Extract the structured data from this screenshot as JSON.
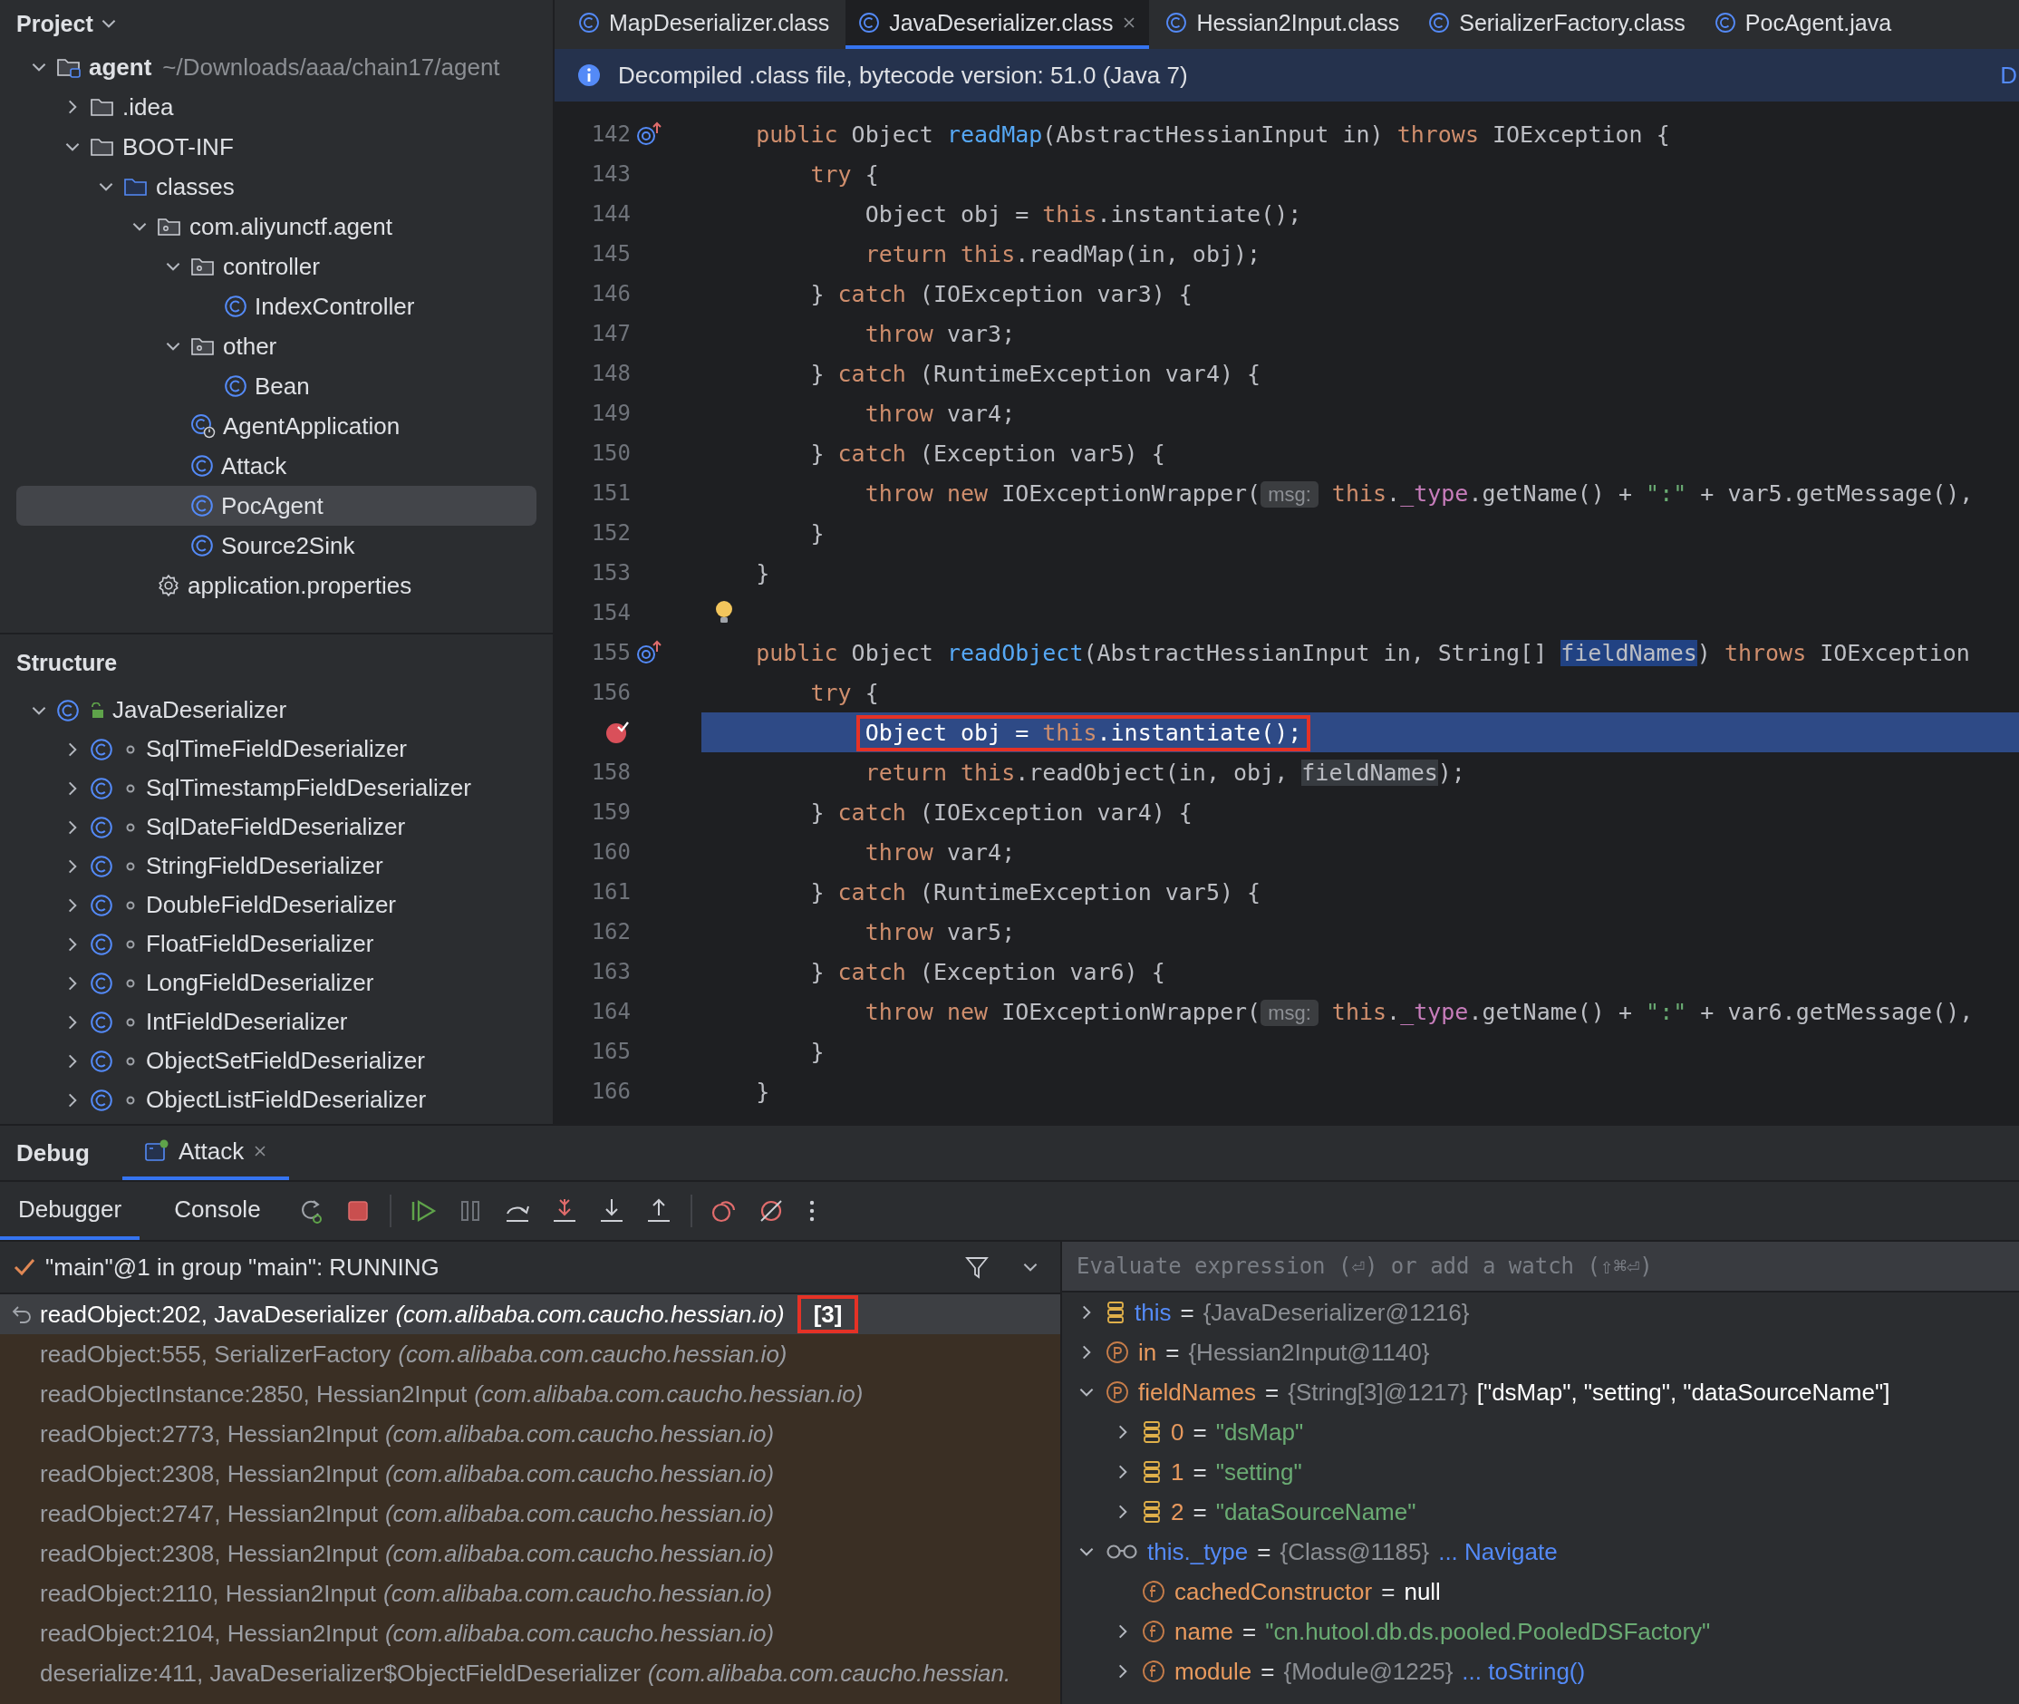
{
  "project_panel": {
    "title": "Project",
    "tree": [
      {
        "label": "agent",
        "detail": "~/Downloads/aaa/chain17/agent",
        "kind": "module",
        "expanded": true,
        "selected": false,
        "children": [
          {
            "label": ".idea",
            "kind": "folder",
            "expanded": false,
            "selected": false
          },
          {
            "label": "BOOT-INF",
            "kind": "folder",
            "expanded": true,
            "selected": false,
            "children": [
              {
                "label": "classes",
                "kind": "source-folder",
                "expanded": true,
                "selected": false,
                "children": [
                  {
                    "label": "com.aliyunctf.agent",
                    "kind": "package",
                    "expanded": true,
                    "selected": false,
                    "children": [
                      {
                        "label": "controller",
                        "kind": "package",
                        "expanded": true,
                        "selected": false,
                        "children": [
                          {
                            "label": "IndexController",
                            "kind": "class",
                            "selected": false
                          }
                        ]
                      },
                      {
                        "label": "other",
                        "kind": "package",
                        "expanded": true,
                        "selected": false,
                        "children": [
                          {
                            "label": "Bean",
                            "kind": "class",
                            "selected": false
                          }
                        ]
                      },
                      {
                        "label": "AgentApplication",
                        "kind": "app-class",
                        "selected": false
                      },
                      {
                        "label": "Attack",
                        "kind": "class",
                        "selected": false
                      },
                      {
                        "label": "PocAgent",
                        "kind": "class",
                        "selected": true
                      },
                      {
                        "label": "Source2Sink",
                        "kind": "class",
                        "selected": false
                      }
                    ]
                  },
                  {
                    "label": "application.properties",
                    "kind": "settings",
                    "selected": false
                  }
                ]
              }
            ]
          }
        ]
      }
    ]
  },
  "structure_panel": {
    "title": "Structure",
    "tree": [
      {
        "label": "JavaDeserializer",
        "kind": "public-class",
        "expanded": true,
        "children": [
          {
            "label": "SqlTimeFieldDeserializer",
            "kind": "package-class",
            "expanded": false
          },
          {
            "label": "SqlTimestampFieldDeserializer",
            "kind": "package-class",
            "expanded": false
          },
          {
            "label": "SqlDateFieldDeserializer",
            "kind": "package-class",
            "expanded": false
          },
          {
            "label": "StringFieldDeserializer",
            "kind": "package-class",
            "expanded": false
          },
          {
            "label": "DoubleFieldDeserializer",
            "kind": "package-class",
            "expanded": false
          },
          {
            "label": "FloatFieldDeserializer",
            "kind": "package-class",
            "expanded": false
          },
          {
            "label": "LongFieldDeserializer",
            "kind": "package-class",
            "expanded": false
          },
          {
            "label": "IntFieldDeserializer",
            "kind": "package-class",
            "expanded": false
          },
          {
            "label": "ObjectSetFieldDeserializer",
            "kind": "package-class",
            "expanded": false
          },
          {
            "label": "ObjectListFieldDeserializer",
            "kind": "package-class",
            "expanded": false
          }
        ]
      }
    ]
  },
  "editor": {
    "tabs": [
      {
        "label": "MapDeserializer.class",
        "selected": false
      },
      {
        "label": "JavaDeserializer.class",
        "selected": true
      },
      {
        "label": "Hessian2Input.class",
        "selected": false
      },
      {
        "label": "SerializerFactory.class",
        "selected": false
      },
      {
        "label": "PocAgent.java",
        "selected": false
      }
    ],
    "banner": {
      "text": "Decompiled .class file, bytecode version: 51.0 (Java 7)",
      "link": "D"
    },
    "lines": [
      {
        "number": "142",
        "kind": "override",
        "tokens": [
          {
            "kind": "kw",
            "text": "    public"
          },
          {
            "kind": "pl",
            "text": " Object "
          },
          {
            "kind": "fn",
            "text": "readMap"
          },
          {
            "kind": "pl",
            "text": "(AbstractHessianInput in) "
          },
          {
            "kind": "kw",
            "text": "throws"
          },
          {
            "kind": "pl",
            "text": " IOException {"
          }
        ]
      },
      {
        "number": "143",
        "kind": "code",
        "tokens": [
          {
            "kind": "kw",
            "text": "        try"
          },
          {
            "kind": "pl",
            "text": " {"
          }
        ]
      },
      {
        "number": "144",
        "kind": "code",
        "tokens": [
          {
            "kind": "pl",
            "text": "            Object obj = "
          },
          {
            "kind": "kw",
            "text": "this"
          },
          {
            "kind": "pl",
            "text": ".instantiate();"
          }
        ]
      },
      {
        "number": "145",
        "kind": "code",
        "tokens": [
          {
            "kind": "kw",
            "text": "            return this"
          },
          {
            "kind": "pl",
            "text": ".readMap(in, obj);"
          }
        ]
      },
      {
        "number": "146",
        "kind": "code",
        "tokens": [
          {
            "kind": "pl",
            "text": "        } "
          },
          {
            "kind": "kw",
            "text": "catch"
          },
          {
            "kind": "pl",
            "text": " (IOException var3) {"
          }
        ]
      },
      {
        "number": "147",
        "kind": "code",
        "tokens": [
          {
            "kind": "kw",
            "text": "            throw"
          },
          {
            "kind": "pl",
            "text": " var3;"
          }
        ]
      },
      {
        "number": "148",
        "kind": "code",
        "tokens": [
          {
            "kind": "pl",
            "text": "        } "
          },
          {
            "kind": "kw",
            "text": "catch"
          },
          {
            "kind": "pl",
            "text": " (RuntimeException var4) {"
          }
        ]
      },
      {
        "number": "149",
        "kind": "code",
        "tokens": [
          {
            "kind": "kw",
            "text": "            throw"
          },
          {
            "kind": "pl",
            "text": " var4;"
          }
        ]
      },
      {
        "number": "150",
        "kind": "code",
        "tokens": [
          {
            "kind": "pl",
            "text": "        } "
          },
          {
            "kind": "kw",
            "text": "catch"
          },
          {
            "kind": "pl",
            "text": " (Exception var5) {"
          }
        ]
      },
      {
        "number": "151",
        "kind": "code",
        "tokens": [
          {
            "kind": "kw",
            "text": "            throw new"
          },
          {
            "kind": "pl",
            "text": " IOExceptionWrapper("
          },
          {
            "kind": "hint",
            "text": "msg:"
          },
          {
            "kind": "kw",
            "text": " this"
          },
          {
            "kind": "pl",
            "text": "."
          },
          {
            "kind": "field",
            "text": "_type"
          },
          {
            "kind": "pl",
            "text": ".getName() + "
          },
          {
            "kind": "str",
            "text": "\":\""
          },
          {
            "kind": "pl",
            "text": " + var5.getMessage(),"
          }
        ]
      },
      {
        "number": "152",
        "kind": "code",
        "tokens": [
          {
            "kind": "pl",
            "text": "        }"
          }
        ]
      },
      {
        "number": "153",
        "kind": "code",
        "tokens": [
          {
            "kind": "pl",
            "text": "    }"
          }
        ]
      },
      {
        "number": "154",
        "kind": "bulb"
      },
      {
        "number": "155",
        "kind": "override",
        "tokens": [
          {
            "kind": "kw",
            "text": "    public"
          },
          {
            "kind": "pl",
            "text": " Object "
          },
          {
            "kind": "fn",
            "text": "readObject"
          },
          {
            "kind": "pl",
            "text": "(AbstractHessianInput in, String[] "
          },
          {
            "kind": "hl",
            "text": "fieldNames"
          },
          {
            "kind": "pl",
            "text": ") "
          },
          {
            "kind": "kw",
            "text": "throws"
          },
          {
            "kind": "pl",
            "text": " IOException"
          }
        ]
      },
      {
        "number": "156",
        "kind": "code",
        "tokens": [
          {
            "kind": "kw",
            "text": "        try"
          },
          {
            "kind": "pl",
            "text": " {"
          }
        ]
      },
      {
        "kind": "breakpoint",
        "current": true,
        "boxed": true,
        "tokens": [
          {
            "kind": "pl",
            "text": "            Object obj = "
          },
          {
            "kind": "kw",
            "text": "this"
          },
          {
            "kind": "pl",
            "text": ".instantiate();"
          }
        ]
      },
      {
        "number": "158",
        "kind": "code",
        "tokens": [
          {
            "kind": "kw",
            "text": "            return this"
          },
          {
            "kind": "pl",
            "text": ".readObject(in, obj, "
          },
          {
            "kind": "usage",
            "text": "fieldNames"
          },
          {
            "kind": "pl",
            "text": ");"
          }
        ]
      },
      {
        "number": "159",
        "kind": "code",
        "tokens": [
          {
            "kind": "pl",
            "text": "        } "
          },
          {
            "kind": "kw",
            "text": "catch"
          },
          {
            "kind": "pl",
            "text": " (IOException var4) {"
          }
        ]
      },
      {
        "number": "160",
        "kind": "code",
        "tokens": [
          {
            "kind": "kw",
            "text": "            throw"
          },
          {
            "kind": "pl",
            "text": " var4;"
          }
        ]
      },
      {
        "number": "161",
        "kind": "code",
        "tokens": [
          {
            "kind": "pl",
            "text": "        } "
          },
          {
            "kind": "kw",
            "text": "catch"
          },
          {
            "kind": "pl",
            "text": " (RuntimeException var5) {"
          }
        ]
      },
      {
        "number": "162",
        "kind": "code",
        "tokens": [
          {
            "kind": "kw",
            "text": "            throw"
          },
          {
            "kind": "pl",
            "text": " var5;"
          }
        ]
      },
      {
        "number": "163",
        "kind": "code",
        "tokens": [
          {
            "kind": "pl",
            "text": "        } "
          },
          {
            "kind": "kw",
            "text": "catch"
          },
          {
            "kind": "pl",
            "text": " (Exception var6) {"
          }
        ]
      },
      {
        "number": "164",
        "kind": "code",
        "tokens": [
          {
            "kind": "kw",
            "text": "            throw new"
          },
          {
            "kind": "pl",
            "text": " IOExceptionWrapper("
          },
          {
            "kind": "hint",
            "text": "msg:"
          },
          {
            "kind": "kw",
            "text": " this"
          },
          {
            "kind": "pl",
            "text": "."
          },
          {
            "kind": "field",
            "text": "_type"
          },
          {
            "kind": "pl",
            "text": ".getName() + "
          },
          {
            "kind": "str",
            "text": "\":\""
          },
          {
            "kind": "pl",
            "text": " + var6.getMessage(),"
          }
        ]
      },
      {
        "number": "165",
        "kind": "code",
        "tokens": [
          {
            "kind": "pl",
            "text": "        }"
          }
        ]
      },
      {
        "number": "166",
        "kind": "code",
        "tokens": [
          {
            "kind": "pl",
            "text": "    }"
          }
        ]
      }
    ]
  },
  "debug": {
    "title": "Debug",
    "tabs": [
      {
        "label": "Attack",
        "selected": true
      }
    ],
    "subtabs": [
      {
        "label": "Debugger",
        "selected": true
      },
      {
        "label": "Console",
        "selected": false
      }
    ],
    "thread": "\"main\"@1 in group \"main\": RUNNING",
    "frames": [
      {
        "method": "readObject:202, JavaDeserializer",
        "package": "(com.alibaba.com.caucho.hessian.io)",
        "count": "[3]",
        "boxed": true,
        "selected": true
      },
      {
        "method": "readObject:555, SerializerFactory",
        "package": "(com.alibaba.com.caucho.hessian.io)",
        "selected": false
      },
      {
        "method": "readObjectInstance:2850, Hessian2Input",
        "package": "(com.alibaba.com.caucho.hessian.io)",
        "selected": false
      },
      {
        "method": "readObject:2773, Hessian2Input",
        "package": "(com.alibaba.com.caucho.hessian.io)",
        "selected": false
      },
      {
        "method": "readObject:2308, Hessian2Input",
        "package": "(com.alibaba.com.caucho.hessian.io)",
        "selected": false
      },
      {
        "method": "readObject:2747, Hessian2Input",
        "package": "(com.alibaba.com.caucho.hessian.io)",
        "selected": false
      },
      {
        "method": "readObject:2308, Hessian2Input",
        "package": "(com.alibaba.com.caucho.hessian.io)",
        "selected": false
      },
      {
        "method": "readObject:2110, Hessian2Input",
        "package": "(com.alibaba.com.caucho.hessian.io)",
        "selected": false
      },
      {
        "method": "readObject:2104, Hessian2Input",
        "package": "(com.alibaba.com.caucho.hessian.io)",
        "selected": false
      },
      {
        "method": "deserialize:411, JavaDeserializer$ObjectFieldDeserializer",
        "package": "(com.alibaba.com.caucho.hessian.",
        "selected": false
      }
    ],
    "watch": {
      "placeholder": "Evaluate expression (⏎) or add a watch (⇧⌘⏎)"
    },
    "variables": [
      {
        "kind": "this",
        "name": "this",
        "op": "=",
        "ref": "{JavaDeserializer@1216}",
        "expanded": false
      },
      {
        "kind": "param",
        "name": "in",
        "op": "=",
        "ref": "{Hessian2Input@1140}",
        "expanded": false
      },
      {
        "kind": "param",
        "name": "fieldNames",
        "op": "=",
        "ref": "{String[3]@1217}",
        "value": "[\"dsMap\", \"setting\", \"dataSourceName\"]",
        "expanded": true,
        "children": [
          {
            "kind": "element",
            "name": "0",
            "op": "=",
            "string": "\"dsMap\"",
            "expanded": false
          },
          {
            "kind": "element",
            "name": "1",
            "op": "=",
            "string": "\"setting\"",
            "expanded": false
          },
          {
            "kind": "element",
            "name": "2",
            "op": "=",
            "string": "\"dataSourceName\"",
            "expanded": false
          }
        ]
      },
      {
        "kind": "watch",
        "name": "this._type",
        "op": "=",
        "ref": "{Class@1185}",
        "link": "... Navigate",
        "expanded": true,
        "children": [
          {
            "kind": "field",
            "name": "cachedConstructor",
            "op": "=",
            "value": "null"
          },
          {
            "kind": "field",
            "name": "name",
            "op": "=",
            "string": "\"cn.hutool.db.ds.pooled.PooledDSFactory\"",
            "expanded": false
          },
          {
            "kind": "field",
            "name": "module",
            "op": "=",
            "ref": "{Module@1225}",
            "link": "... toString()",
            "expanded": false
          }
        ]
      }
    ]
  }
}
